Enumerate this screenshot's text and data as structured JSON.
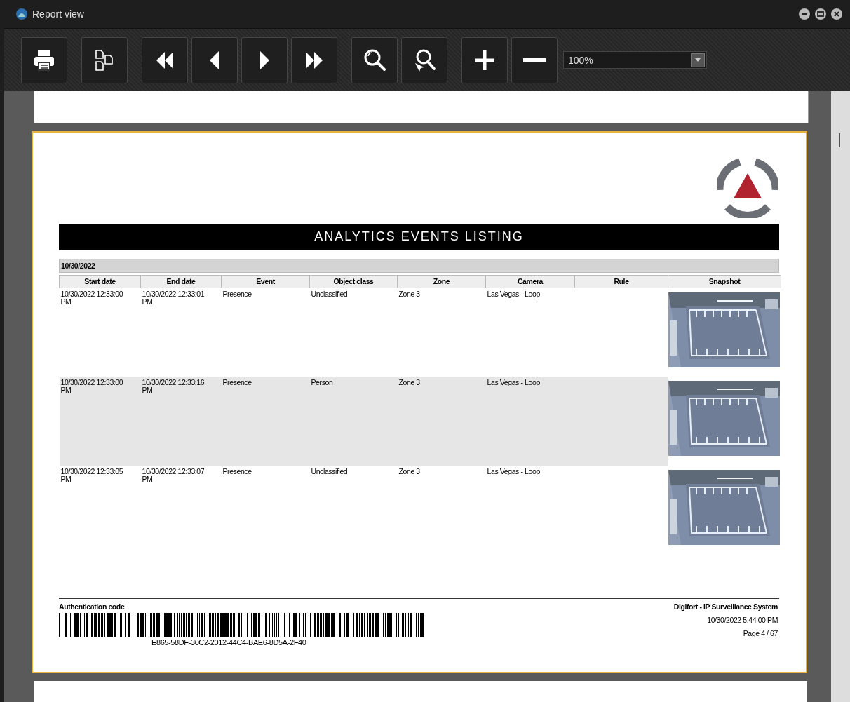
{
  "window": {
    "title": "Report view"
  },
  "toolbar": {
    "zoom": "100%"
  },
  "report": {
    "title": "ANALYTICS EVENTS LISTING",
    "group": "10/30/2022",
    "columns": [
      "Start date",
      "End date",
      "Event",
      "Object class",
      "Zone",
      "Camera",
      "Rule",
      "Snapshot"
    ],
    "rows": [
      {
        "cells": [
          "10/30/2022 12:33:00 PM",
          "10/30/2022 12:33:01 PM",
          "Presence",
          "Unclassified",
          "Zone 3",
          "Las Vegas - Loop",
          ""
        ],
        "highlighted": false,
        "snapshot": {
          "kind": "picture"
        }
      },
      {
        "cells": [
          "10/30/2022 12:33:00 PM",
          "10/30/2022 12:33:16 PM",
          "Presence",
          "Person",
          "Zone 3",
          "Las Vegas - Loop",
          ""
        ],
        "highlighted": true,
        "snapshot": {
          "kind": "picture"
        }
      },
      {
        "cells": [
          "10/30/2022 12:33:05 PM",
          "10/30/2022 12:33:07 PM",
          "Presence",
          "Unclassified",
          "Zone 3",
          "Las Vegas - Loop",
          ""
        ],
        "highlighted": false,
        "snapshot": {
          "kind": "picture"
        }
      }
    ],
    "footer": {
      "auth_label": "Authentication code",
      "auth_code": "E865-58DF-30C2-2012-44C4-BAE6-8D5A-2F40",
      "system": "Digifort - IP Surveillance System",
      "printed": "10/30/2022 5:44:00 PM",
      "page": "Page 4 / 67"
    }
  }
}
